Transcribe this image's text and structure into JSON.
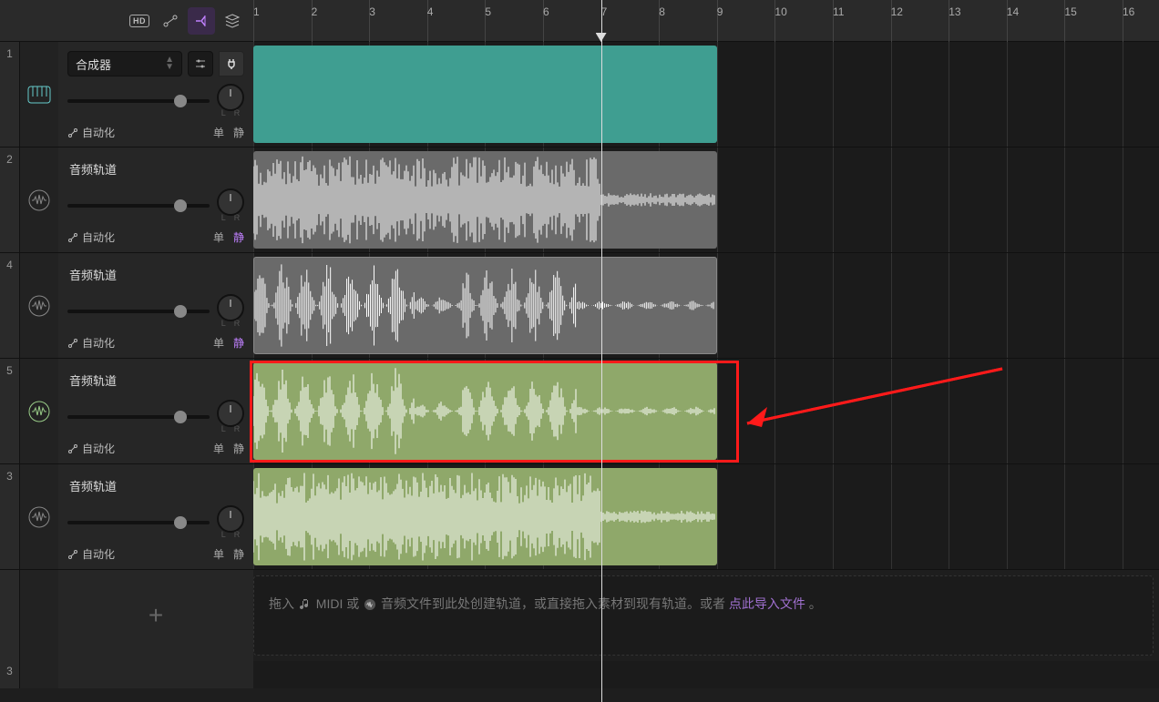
{
  "ruler": {
    "start": 1,
    "end": 16
  },
  "playhead_bar": 7,
  "clip_end_bar": 9,
  "toolbar": {
    "hd_label": "HD"
  },
  "tracks": [
    {
      "number": "1",
      "name": "合成器",
      "type": "synth",
      "automation": "自动化",
      "solo": "单",
      "mute": "静",
      "mute_active": false,
      "lr": [
        "L",
        "R"
      ],
      "vol": 0.75
    },
    {
      "number": "2",
      "name": "音频轨道",
      "type": "audio",
      "automation": "自动化",
      "solo": "单",
      "mute": "静",
      "mute_active": true,
      "lr": [
        "L",
        "R"
      ],
      "vol": 0.75
    },
    {
      "number": "4",
      "name": "音频轨道",
      "type": "audio",
      "automation": "自动化",
      "solo": "单",
      "mute": "静",
      "mute_active": true,
      "lr": [
        "L",
        "R"
      ],
      "vol": 0.75,
      "clip_style": "gray-outline"
    },
    {
      "number": "5",
      "name": "音频轨道",
      "type": "audio",
      "automation": "自动化",
      "solo": "单",
      "mute": "静",
      "mute_active": false,
      "lr": [
        "L",
        "R"
      ],
      "vol": 0.75,
      "highlight": true
    },
    {
      "number": "3",
      "name": "音频轨道",
      "type": "audio",
      "automation": "自动化",
      "solo": "单",
      "mute": "静",
      "mute_active": false,
      "lr": [
        "L",
        "R"
      ],
      "vol": 0.75
    }
  ],
  "dropzone": {
    "prefix": "拖入 ",
    "midi": "MIDI 或 ",
    "audio_text": "音频文件到此处创建轨道，或直接拖入素材到现有轨道。或者 ",
    "link": "点此导入文件",
    "suffix": " 。"
  },
  "bottom_number": "3"
}
